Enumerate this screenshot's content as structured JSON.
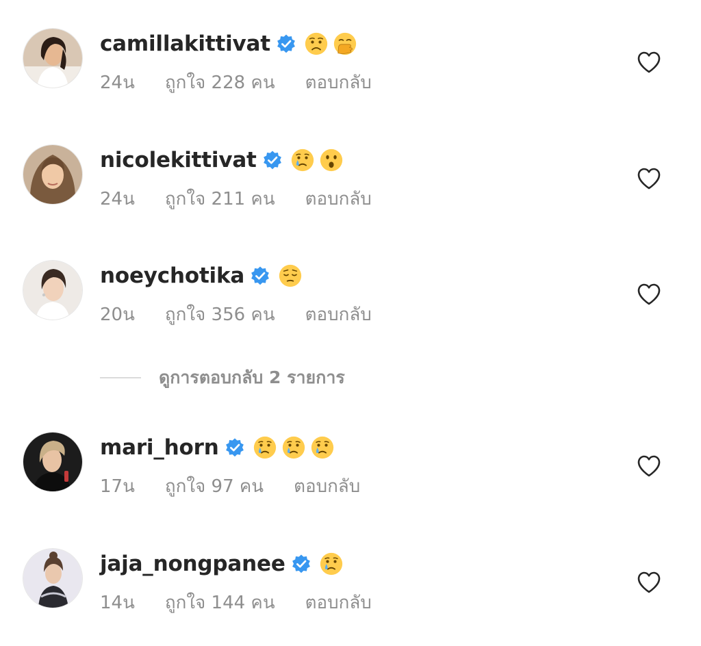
{
  "comments": [
    {
      "username": "camillakittivat",
      "verified": true,
      "emojis": [
        "worried-face",
        "face-with-hand-over-mouth"
      ],
      "time": "24น",
      "likes": "ถูกใจ 228 คน",
      "reply": "ตอบกลับ"
    },
    {
      "username": "nicolekittivat",
      "verified": true,
      "emojis": [
        "crying-face",
        "hushed-face"
      ],
      "time": "24น",
      "likes": "ถูกใจ 211 คน",
      "reply": "ตอบกลับ"
    },
    {
      "username": "noeychotika",
      "verified": true,
      "emojis": [
        "pensive-face"
      ],
      "time": "20น",
      "likes": "ถูกใจ 356 คน",
      "reply": "ตอบกลับ"
    },
    {
      "username": "mari_horn",
      "verified": true,
      "emojis": [
        "crying-face",
        "crying-face",
        "crying-face"
      ],
      "time": "17น",
      "likes": "ถูกใจ 97 คน",
      "reply": "ตอบกลับ"
    },
    {
      "username": "jaja_nongpanee",
      "verified": true,
      "emojis": [
        "crying-face"
      ],
      "time": "14น",
      "likes": "ถูกใจ 144 คน",
      "reply": "ตอบกลับ"
    }
  ],
  "view_replies": "ดูการตอบกลับ 2 รายการ",
  "icons": {
    "verified": "verified-badge-icon",
    "like": "heart-outline-icon"
  },
  "colors": {
    "verified": "#3897f0",
    "text": "#262626",
    "muted": "#8e8e8e",
    "emoji": "#ffcc4d"
  }
}
